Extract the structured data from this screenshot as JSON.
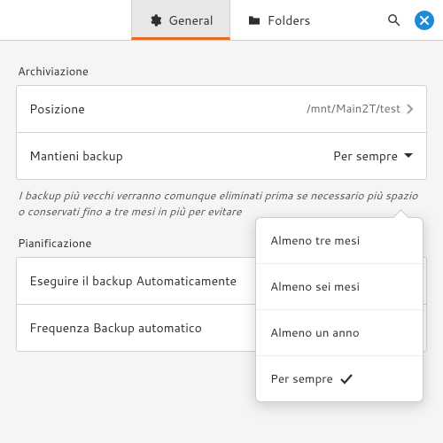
{
  "tabs": {
    "general": "General",
    "folders": "Folders"
  },
  "sections": {
    "storage_title": "Archiviazione",
    "scheduling_title": "Pianificazione"
  },
  "rows": {
    "location_label": "Posizione",
    "location_value": "/mnt/Main2T/test",
    "keep_label": "Mantieni backup",
    "keep_value": "Per sempre",
    "auto_label": "Eseguire il backup Automaticamente",
    "freq_label": "Frequenza Backup automatico"
  },
  "hint": "I backup più vecchi verranno comunque eliminati prima se necessario più spazio o conservati fino a tre mesi in più per evitare",
  "dropdown": {
    "opt1": "Almeno tre mesi",
    "opt2": "Almeno sei mesi",
    "opt3": "Almeno un anno",
    "opt4": "Per sempre"
  }
}
